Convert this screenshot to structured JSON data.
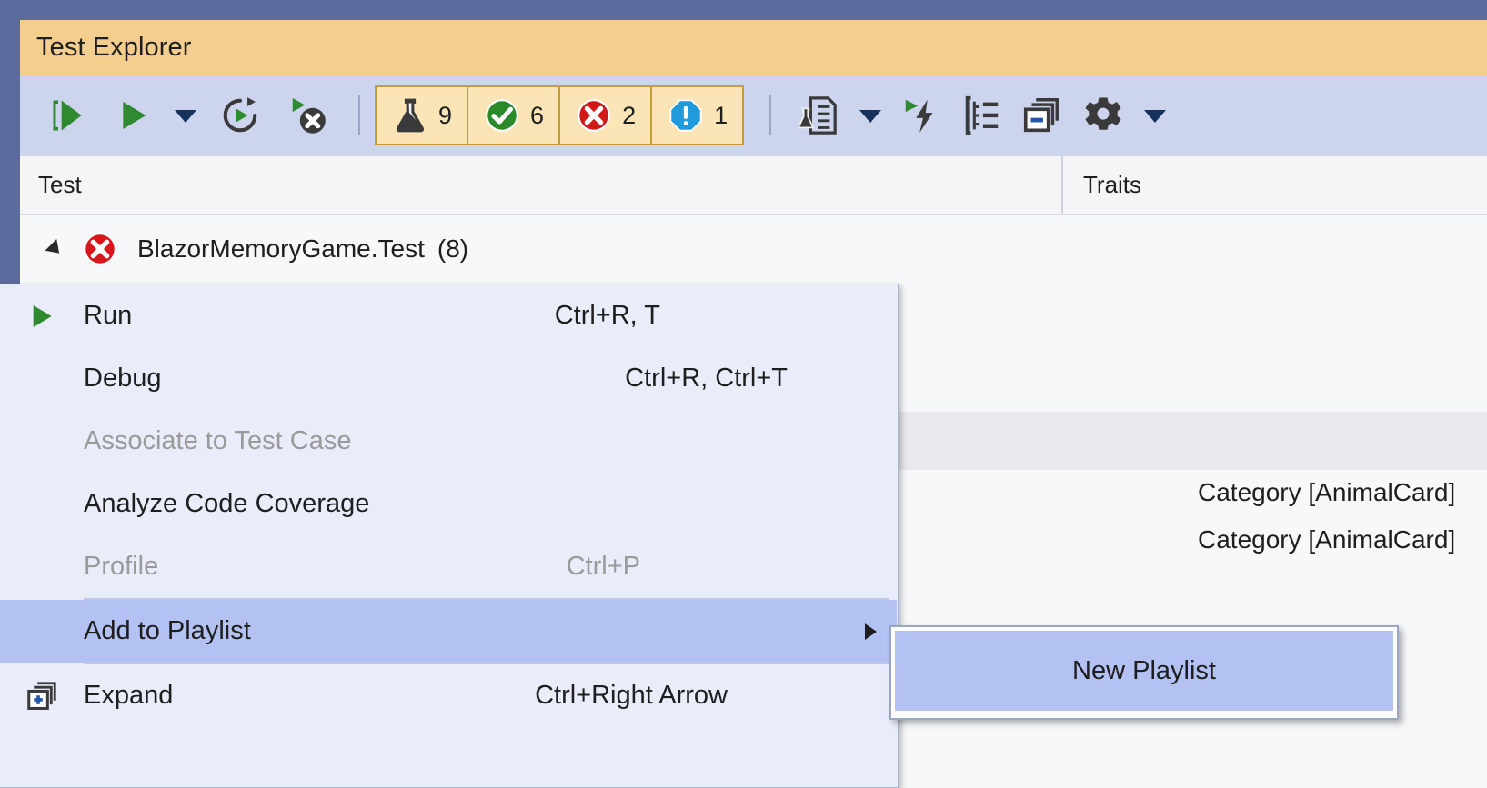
{
  "window": {
    "title": "Test Explorer"
  },
  "toolbar": {
    "buttons": [
      {
        "name": "run-all-tests",
        "icon": "run-all-icon",
        "tooltip": "Run All Tests In View"
      },
      {
        "name": "run-tests",
        "icon": "run-icon",
        "tooltip": "Run"
      },
      {
        "name": "run-dropdown",
        "icon": "chevron-down-icon",
        "tooltip": "Run dropdown"
      },
      {
        "name": "repeat-last-run",
        "icon": "repeat-run-icon",
        "tooltip": "Repeat Last Run"
      },
      {
        "name": "cancel-run",
        "icon": "stop-run-icon",
        "tooltip": "Cancel Test Run"
      }
    ],
    "counters": [
      {
        "name": "total-tests",
        "icon": "flask-icon",
        "value": "9",
        "color": "#3a3a3a"
      },
      {
        "name": "passed-tests",
        "icon": "check-circle-icon",
        "value": "6",
        "color": "#2a8a2a"
      },
      {
        "name": "failed-tests",
        "icon": "error-circle-icon",
        "value": "2",
        "color": "#d01a1a"
      },
      {
        "name": "not-run-tests",
        "icon": "warning-octagon-icon",
        "value": "1",
        "color": "#1f9bdc"
      }
    ],
    "right_buttons": [
      {
        "name": "test-detail-summary",
        "icon": "test-document-icon"
      },
      {
        "name": "test-detail-dropdown",
        "icon": "chevron-down-icon"
      },
      {
        "name": "run-until-failure",
        "icon": "run-lightning-icon"
      },
      {
        "name": "group-by",
        "icon": "group-by-icon"
      },
      {
        "name": "expand-collapse-all",
        "icon": "expand-windows-icon"
      },
      {
        "name": "settings",
        "icon": "gear-icon"
      },
      {
        "name": "settings-dropdown",
        "icon": "chevron-down-icon"
      }
    ]
  },
  "columns": [
    {
      "key": "test",
      "label": "Test"
    },
    {
      "key": "traits",
      "label": "Traits"
    }
  ],
  "rows": [
    {
      "indent": 0,
      "expander": "collapse-triangle",
      "status_icon": "error-circle-icon",
      "label": "BlazorMemoryGame.Test",
      "count": "(8)",
      "traits": ""
    },
    {
      "indent": 1,
      "expander": "",
      "status_icon": "",
      "label": "",
      "count": "",
      "traits": ""
    },
    {
      "indent": 1,
      "expander": "",
      "status_icon": "",
      "label": "",
      "count": "",
      "traits": ""
    },
    {
      "indent": 2,
      "expander": "",
      "status_icon": "",
      "label": "",
      "count": "",
      "traits": "Category [AnimalCard]"
    },
    {
      "indent": 2,
      "expander": "",
      "status_icon": "",
      "label": "",
      "count": "",
      "traits": "Category [AnimalCard]"
    }
  ],
  "context_menu": {
    "items": [
      {
        "type": "item",
        "name": "menu-item-run",
        "icon": "run-icon",
        "label": "Run",
        "shortcut": "Ctrl+R, T",
        "disabled": false,
        "selected": false,
        "submenu": false
      },
      {
        "type": "item",
        "name": "menu-item-debug",
        "icon": "",
        "label": "Debug",
        "shortcut": "Ctrl+R, Ctrl+T",
        "disabled": false,
        "selected": false,
        "submenu": false
      },
      {
        "type": "item",
        "name": "menu-item-associate-to-test-case",
        "icon": "",
        "label": "Associate to Test Case",
        "shortcut": "",
        "disabled": true,
        "selected": false,
        "submenu": false
      },
      {
        "type": "item",
        "name": "menu-item-analyze-code-coverage",
        "icon": "",
        "label": "Analyze Code Coverage",
        "shortcut": "",
        "disabled": false,
        "selected": false,
        "submenu": false
      },
      {
        "type": "item",
        "name": "menu-item-profile",
        "icon": "",
        "label": "Profile",
        "shortcut": "Ctrl+P",
        "disabled": true,
        "selected": false,
        "submenu": false
      },
      {
        "type": "separator",
        "name": "menu-separator-1"
      },
      {
        "type": "item",
        "name": "menu-item-add-to-playlist",
        "icon": "",
        "label": "Add to Playlist",
        "shortcut": "",
        "disabled": false,
        "selected": true,
        "submenu": true
      },
      {
        "type": "separator",
        "name": "menu-separator-2"
      },
      {
        "type": "item",
        "name": "menu-item-expand",
        "icon": "expand-windows-icon",
        "label": "Expand",
        "shortcut": "Ctrl+Right Arrow",
        "disabled": false,
        "selected": false,
        "submenu": false
      }
    ]
  },
  "submenu": {
    "items": [
      {
        "name": "submenu-item-new-playlist",
        "label": "New Playlist",
        "selected": true
      }
    ]
  },
  "colors": {
    "title_bar": "#f4ce8e",
    "toolbar": "#ccd4ee",
    "frame": "#5c6a9e",
    "menu_bg": "#e9edfa",
    "menu_highlight": "#b3c2f2",
    "counter_bg": "#fbe5b6",
    "counter_border": "#c99a3c"
  }
}
